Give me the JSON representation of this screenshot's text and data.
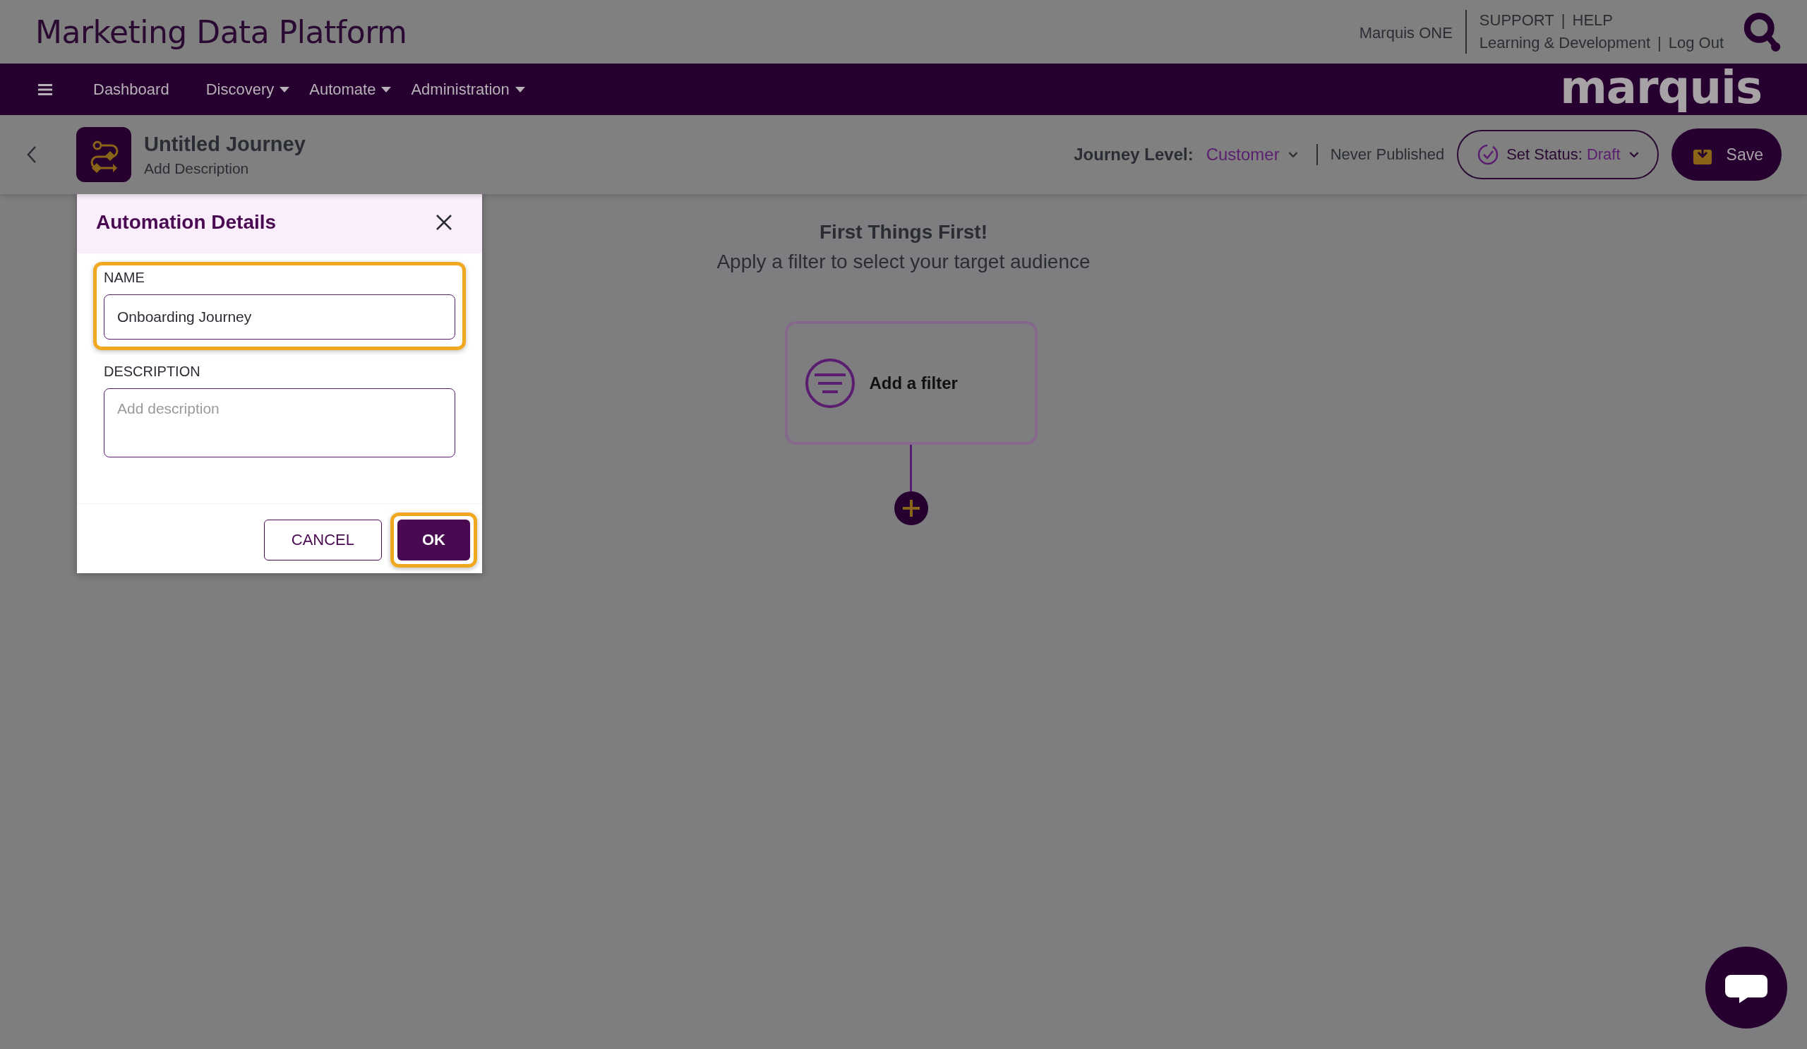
{
  "header": {
    "title": "Marketing Data Platform",
    "product_link": "Marquis ONE",
    "link_lines": [
      {
        "links": [
          "SUPPORT",
          "HELP"
        ],
        "separator": "|"
      },
      {
        "links": [
          "Learning & Development",
          "Log Out"
        ],
        "separator": "|"
      }
    ]
  },
  "nav": {
    "items": [
      {
        "label": "Dashboard",
        "has_dropdown": false
      },
      {
        "label": "Discovery",
        "has_dropdown": true
      },
      {
        "label": "Automate",
        "has_dropdown": true
      },
      {
        "label": "Administration",
        "has_dropdown": true
      }
    ],
    "logo": "marquis"
  },
  "journey": {
    "title": "Untitled Journey",
    "description": "Add Description",
    "level_label": "Journey Level:",
    "level_value": "Customer",
    "publish_status": "Never Published",
    "status_label": "Set Status:",
    "status_value": "Draft",
    "save": "Save"
  },
  "canvas": {
    "heading": "First Things First!",
    "subheading": "Apply a filter to select your target audience",
    "node": {
      "label": "Add a filter"
    }
  },
  "dialog": {
    "title": "Automation Details",
    "fields": [
      {
        "kind": "input",
        "label": "NAME",
        "value": "Onboarding Journey",
        "highlighted": true
      },
      {
        "kind": "textarea",
        "label": "DESCRIPTION",
        "placeholder": "Add description",
        "highlighted": false
      }
    ],
    "buttons": [
      {
        "kind": "secondary",
        "label": "CANCEL",
        "highlighted": false
      },
      {
        "kind": "primary",
        "label": "OK",
        "highlighted": true
      }
    ]
  }
}
